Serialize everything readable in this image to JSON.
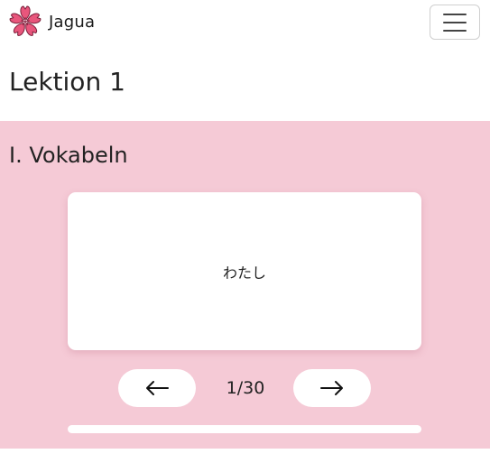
{
  "navbar": {
    "brand_name": "Jagua",
    "logo_icon": "cherry-blossom-icon",
    "menu_icon": "hamburger-menu-icon"
  },
  "page": {
    "title": "Lektion 1"
  },
  "section": {
    "title": "I. Vokabeln",
    "background": "#f5cad6"
  },
  "flashcard": {
    "word": "わたし"
  },
  "controls": {
    "prev_icon": "arrow-left-icon",
    "next_icon": "arrow-right-icon",
    "counter": "1/30",
    "current": 1,
    "total": 30
  },
  "progress": {
    "fraction": 0
  }
}
